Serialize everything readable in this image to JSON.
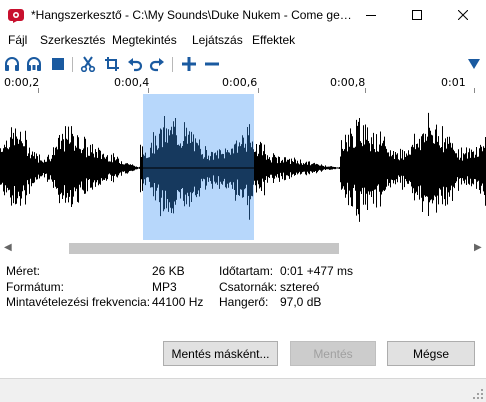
{
  "window": {
    "title": "*Hangszerkesztő - C:\\My Sounds\\Duke Nukem - Come ge…",
    "minimize_icon": "minimize-icon",
    "maximize_icon": "maximize-icon",
    "close_icon": "close-icon",
    "app_icon": "app-logo-icon"
  },
  "menu": {
    "items": [
      {
        "label": "Fájl"
      },
      {
        "label": "Szerkesztés"
      },
      {
        "label": "Megtekintés"
      },
      {
        "label": "Lejátszás"
      },
      {
        "label": "Effektek"
      }
    ]
  },
  "toolbar": {
    "icons": [
      "headphones-play-icon",
      "headphones-play-selection-icon",
      "stop-icon",
      "cut-icon",
      "crop-icon",
      "undo-icon",
      "redo-icon",
      "zoom-in-icon",
      "zoom-out-icon",
      "dropdown-triangle-icon"
    ]
  },
  "timeline": {
    "labels": [
      "0:00,2",
      "0:00,4",
      "0:00,6",
      "0:00,8",
      "0:01"
    ]
  },
  "selection": {
    "start_sec": 0.45,
    "end_sec": 0.65
  },
  "colors": {
    "selection": "#b7d7fb",
    "waveform": "#000000",
    "waveform_selected": "#16395e",
    "accent_blue": "#1a5aa0"
  },
  "info": {
    "size_label": "Méret:",
    "size_value": "26 KB",
    "format_label": "Formátum:",
    "format_value": "MP3",
    "rate_label": "Mintavételezési frekvencia:",
    "rate_value": "44100 Hz",
    "duration_label": "Időtartam:",
    "duration_value": "0:01 +477 ms",
    "channels_label": "Csatornák:",
    "channels_value": "sztereó",
    "volume_label": "Hangerő:",
    "volume_value": "97,0 dB"
  },
  "buttons": {
    "save_as": "Mentés másként...",
    "save": "Mentés",
    "cancel": "Mégse"
  }
}
